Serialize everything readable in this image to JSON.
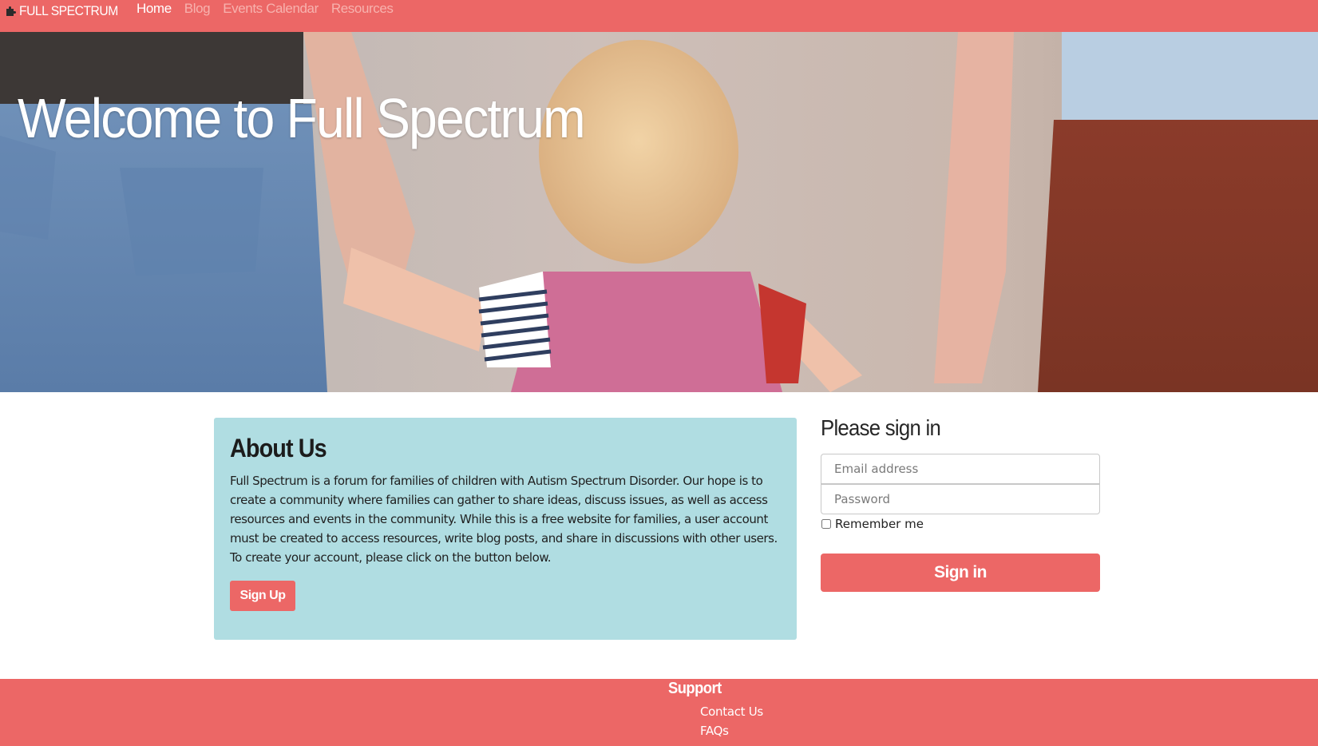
{
  "colors": {
    "brand": "#ec6766",
    "about_bg": "#b0dde2",
    "nav_inactive": "#f7b2ae",
    "text": "#222222"
  },
  "navbar": {
    "brand_icon": "puzzle-piece-icon",
    "brand_label": "FULL SPECTRUM",
    "links": [
      {
        "label": "Home",
        "active": true
      },
      {
        "label": "Blog",
        "active": false
      },
      {
        "label": "Events Calendar",
        "active": false
      },
      {
        "label": "Resources",
        "active": false
      }
    ]
  },
  "hero": {
    "title": "Welcome to Full Spectrum"
  },
  "about": {
    "heading": "About Us",
    "body": "Full Spectrum is a forum for families of children with Autism Spectrum Disorder. Our hope is to create a community where families can gather to share ideas, discuss issues, as well as access resources and events in the community. While this is a free website for families, a user account must be created to access resources, write blog posts, and share in discussions with other users. To create your account, please click on the button below.",
    "signup_label": "Sign Up"
  },
  "signin": {
    "heading": "Please sign in",
    "email_placeholder": "Email address",
    "email_value": "",
    "password_placeholder": "Password",
    "password_value": "",
    "remember_label": "Remember me",
    "remember_checked": false,
    "submit_label": "Sign in"
  },
  "footer": {
    "heading": "Support",
    "links": [
      {
        "label": "Contact Us"
      },
      {
        "label": "FAQs"
      }
    ]
  }
}
